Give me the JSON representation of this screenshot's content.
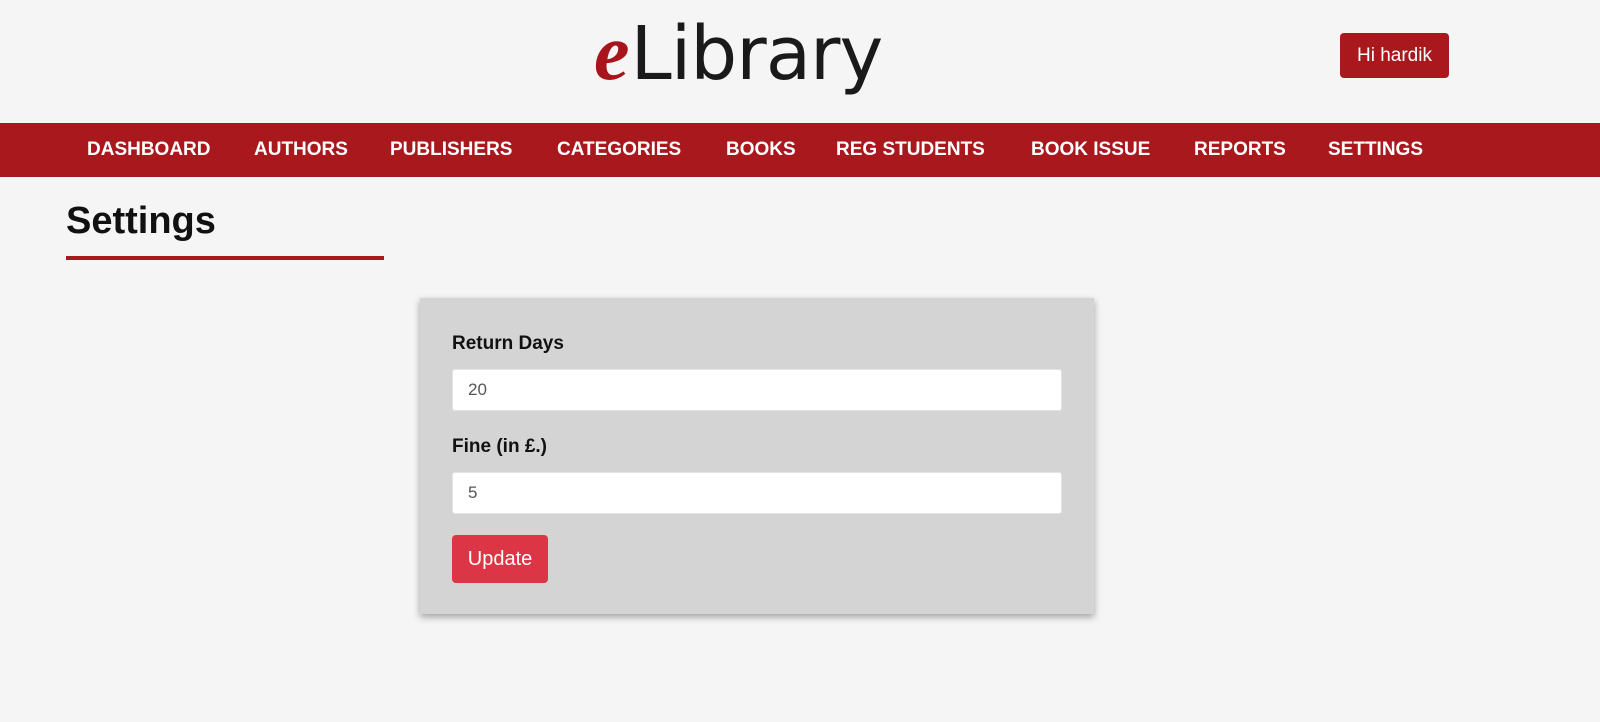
{
  "header": {
    "logo_prefix": "e",
    "logo_text": "Library",
    "user_button": "Hi hardik"
  },
  "nav": {
    "items": [
      {
        "label": "DASHBOARD"
      },
      {
        "label": "AUTHORS"
      },
      {
        "label": "PUBLISHERS"
      },
      {
        "label": "CATEGORIES"
      },
      {
        "label": "BOOKS"
      },
      {
        "label": "REG STUDENTS"
      },
      {
        "label": "BOOK ISSUE"
      },
      {
        "label": "REPORTS"
      },
      {
        "label": "SETTINGS"
      }
    ]
  },
  "page": {
    "title": "Settings"
  },
  "form": {
    "return_days_label": "Return Days",
    "return_days_value": "20",
    "fine_label": "Fine (in £.)",
    "fine_value": "5",
    "update_label": "Update"
  },
  "colors": {
    "brand_red": "#a8181d",
    "button_red": "#dc3545",
    "card_bg": "#d4d4d4",
    "page_bg": "#f5f5f5"
  }
}
